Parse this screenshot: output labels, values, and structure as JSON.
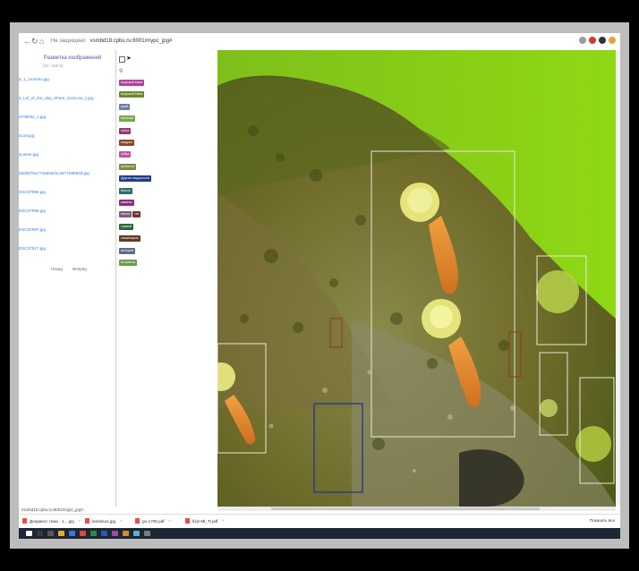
{
  "browser": {
    "site_label": "Не защищено",
    "url": "vsmbd18.cpbu.ru:8001/mypc_jpg#"
  },
  "sidebar": {
    "title": "Разметка изображений",
    "subtitle": "(10 / 169 5)",
    "files": [
      "5_1_mmrmtv.jpg",
      "4_Lol_of_the_day_Shore_Sona.na_1.jpg",
      "d7d6hke_1.jpg",
      "4ca4.jpg",
      "4cwme.jpg",
      "0dd397ba773a6e5d1c4877b95948.jpg",
      "DSC07995.jpg",
      "DSC07996.jpg",
      "DSC07997.jpg",
      "DSC07917.jpg"
    ],
    "footer": [
      "Назад",
      "Вперёд"
    ]
  },
  "tools": {
    "tags": [
      {
        "label": "морской ёжик",
        "color": "#b33f9e"
      },
      {
        "label": "морской ёжик",
        "color": "#6a8a2a"
      },
      {
        "label": "краб",
        "color": "#6b7fa6"
      },
      {
        "label": "актиния",
        "color": "#78a84a"
      },
      {
        "label": "губка",
        "color": "#8a3c6d"
      },
      {
        "label": "медуза",
        "color": "#8b4726"
      },
      {
        "label": "губка",
        "color": "#c24fa0"
      },
      {
        "label": "креветка",
        "color": "#7c8a3c"
      },
      {
        "label": "Другие водоросли",
        "color": "#1f3b86"
      },
      {
        "label": "Бычок",
        "color": "#2a6e62"
      },
      {
        "label": "камень",
        "color": "#8a2d80"
      },
      {
        "label": "песок",
        "color": "#7b5c7a"
      },
      {
        "label": "травой",
        "color": "#286a3a"
      },
      {
        "label": "ламинария",
        "color": "#5d3b28"
      },
      {
        "label": "астерия",
        "color": "#5d6b86"
      },
      {
        "label": "Багрянка",
        "color": "#6a9a4e"
      }
    ],
    "extra_tag": {
      "label": "тиг",
      "color": "#7a2f2f"
    }
  },
  "status_url": "vsmbd18.cpbu.ru:8001/mypc_jpg#",
  "downloads": {
    "items": [
      "Документ тема - 1....jpg",
      "kartinka1.jpg",
      "go-1709.pdf",
      "fizjz-Ml_Tl.pdf"
    ],
    "show_all": "Показать все"
  },
  "colors": {
    "water": "#7fce12",
    "box_white": "#e8e8d8",
    "box_blue": "#2a3e8c",
    "box_brown": "#8a3c1c"
  }
}
